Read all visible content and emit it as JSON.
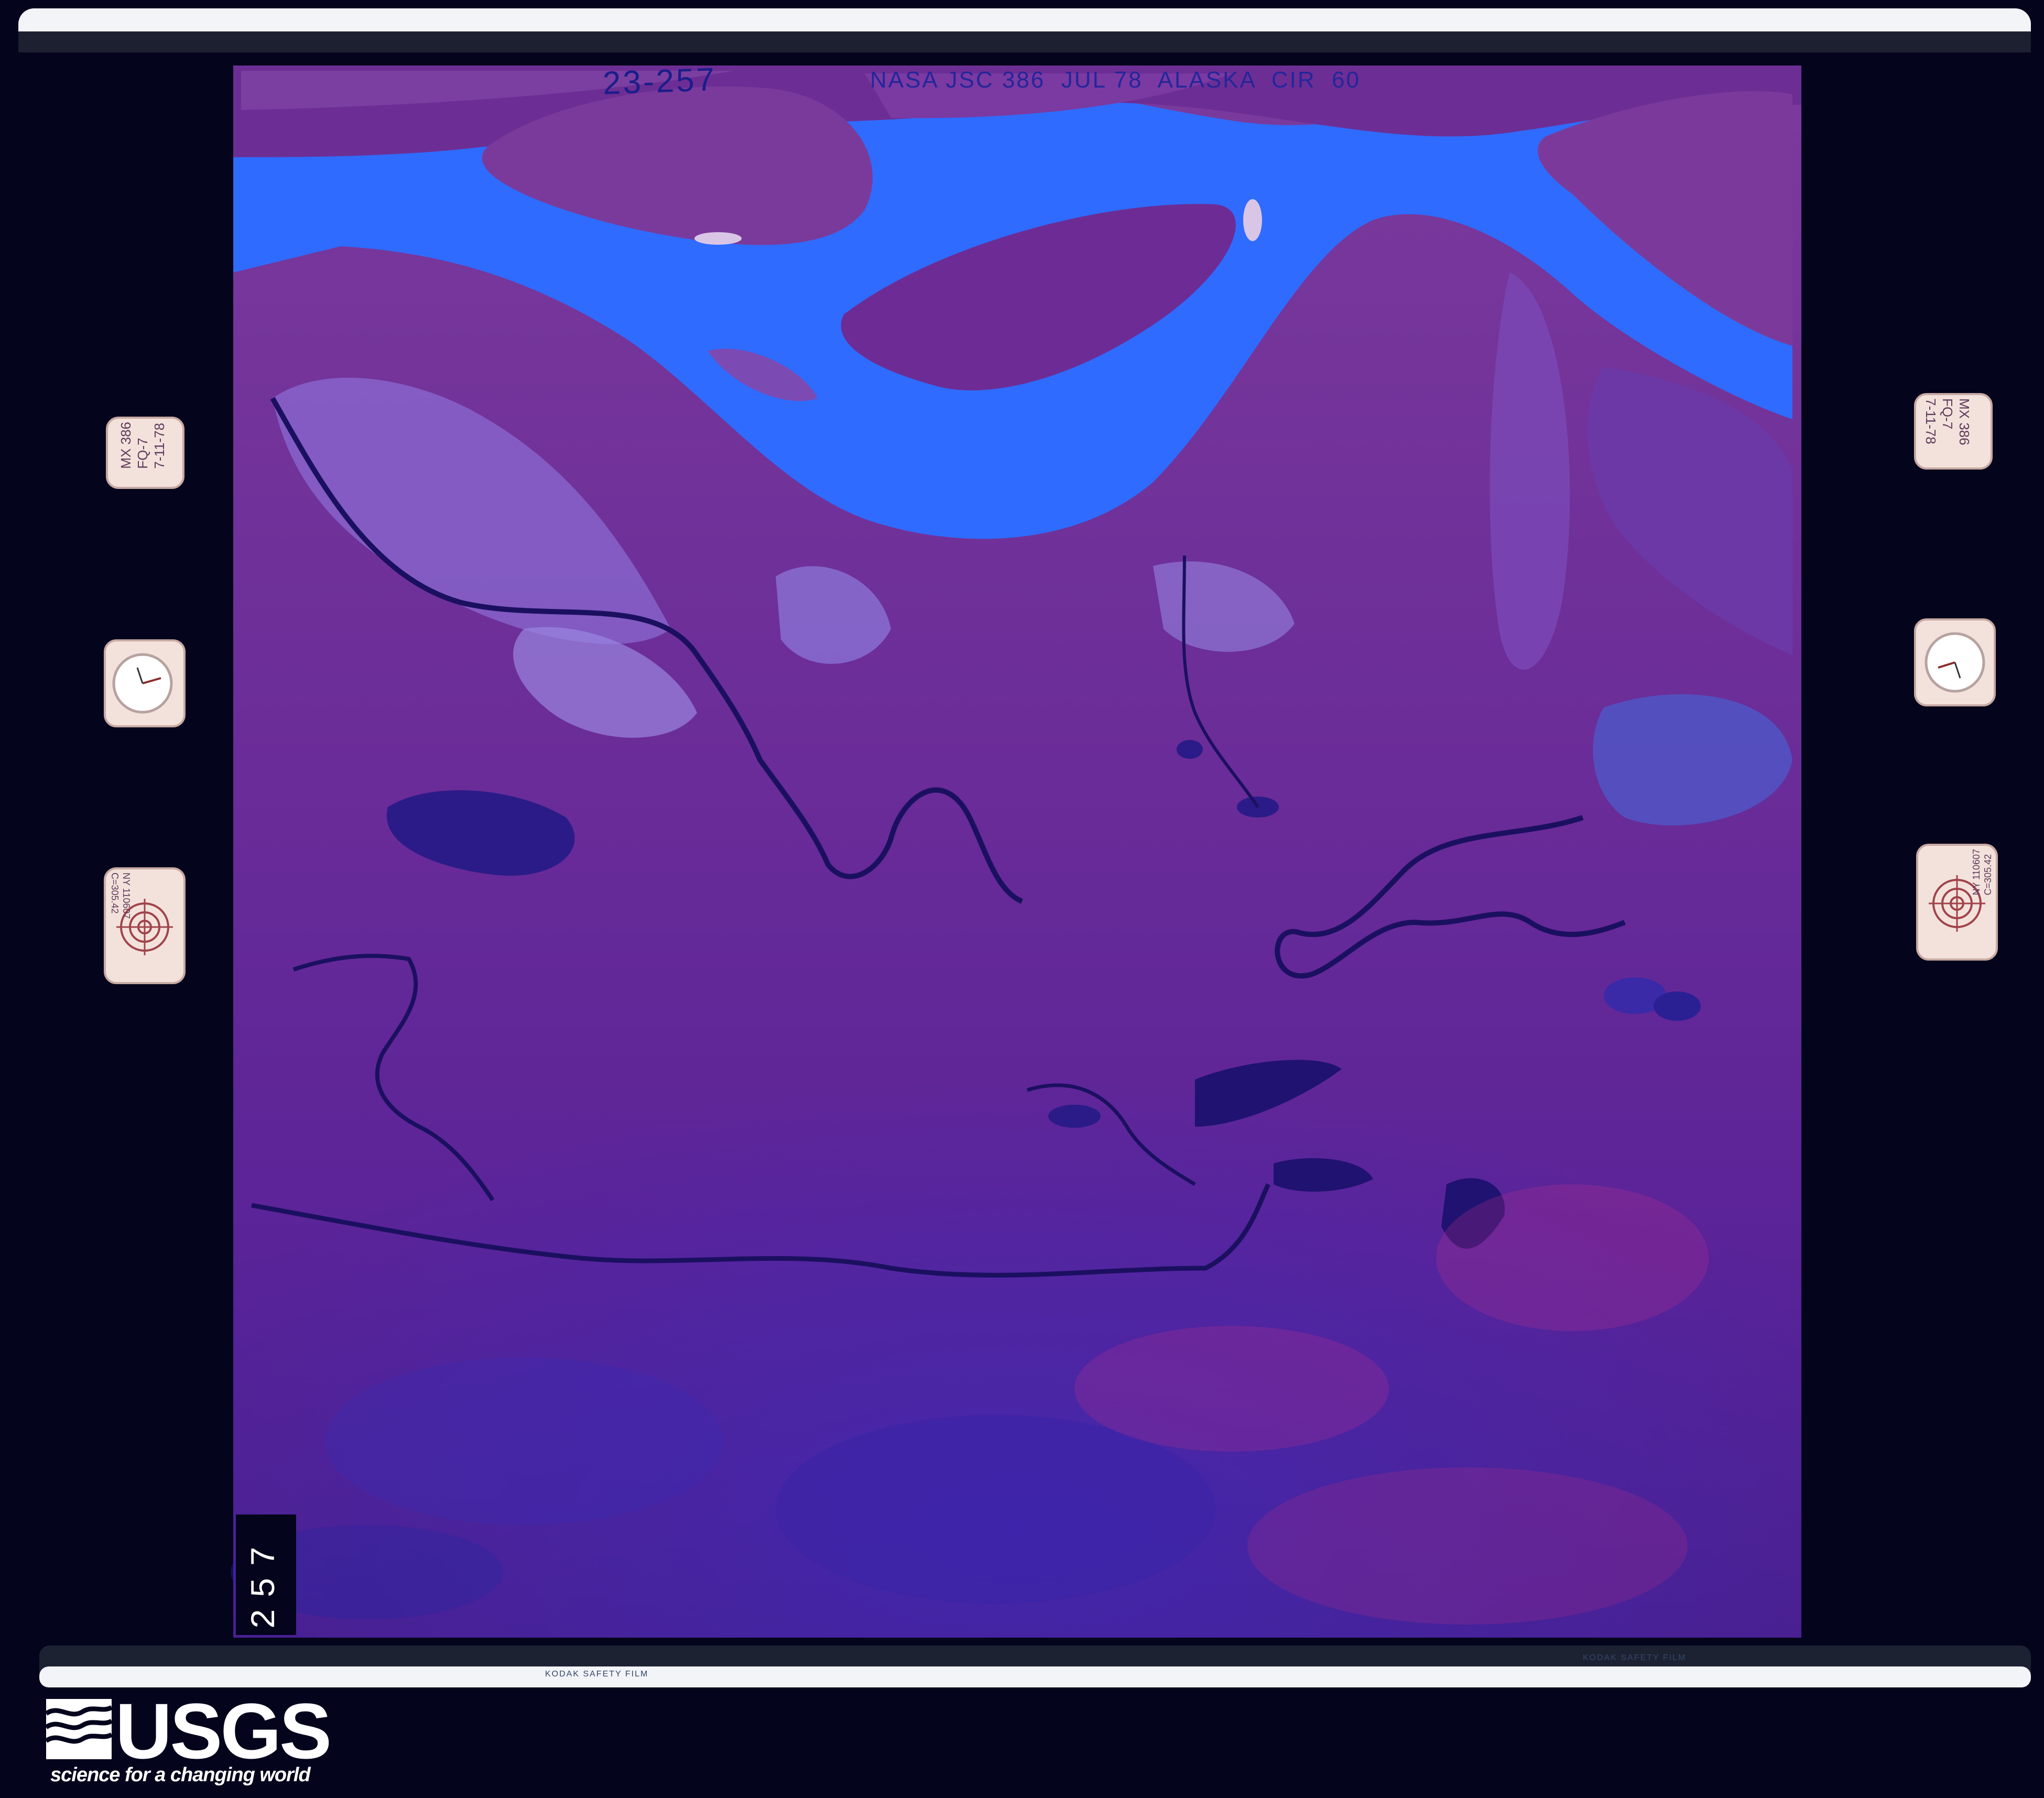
{
  "image": {
    "frame_code": "23-257",
    "mission_label": "NASA JSC 386  JUL 78  ALASKA  CIR  60",
    "frame_number": "257",
    "edge_print": "KODAK SAFETY FILM",
    "side_chips": {
      "calibration_label": "MX 386\nFQ-7\n7-11-78",
      "lens_label": "NY 110607\nC=305.42"
    }
  },
  "branding": {
    "wordmark": "USGS",
    "tagline": "science for a changing world"
  },
  "colors": {
    "background": "#04041c",
    "river": "#2f6bff",
    "terrain": "#6a2a9a",
    "film_rail": "#f2f4f7"
  }
}
